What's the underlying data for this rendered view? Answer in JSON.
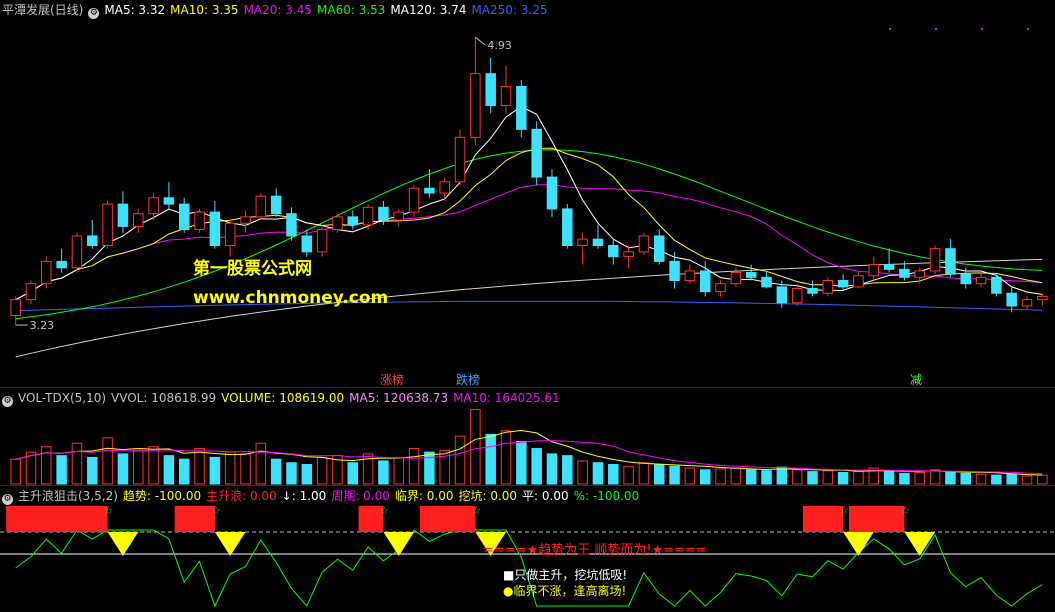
{
  "main": {
    "title": "平潭发展(日线)",
    "ma": [
      {
        "label": "MA5: 3.32",
        "color": "#ffffff"
      },
      {
        "label": "MA10: 3.35",
        "color": "#ffff00"
      },
      {
        "label": "MA20: 3.45",
        "color": "#ff00ff"
      },
      {
        "label": "MA60: 3.53",
        "color": "#00ff00"
      },
      {
        "label": "MA120: 3.74",
        "color": "#ffffff"
      },
      {
        "label": "MA250: 3.25",
        "color": "#3060ff"
      }
    ],
    "high_label": "4.93",
    "low_label": "3.23",
    "watermark_cn": "第一股票公式网",
    "watermark_url": "www.chnmoney.com",
    "events": [
      {
        "text": "涨榜",
        "color": "#ff4040"
      },
      {
        "text": "跌榜",
        "color": "#40a0ff"
      },
      {
        "text": "减",
        "color": "#40ff40"
      }
    ]
  },
  "vol": {
    "items": [
      {
        "label": "VOL-TDX(5,10)",
        "color": "#c0c0c0"
      },
      {
        "label": "VVOL: 108618.99",
        "color": "#c0c0c0"
      },
      {
        "label": "VOLUME: 108619.00",
        "color": "#ffff00"
      },
      {
        "label": "MA5: 120638.73",
        "color": "#ff80ff"
      },
      {
        "label": "MA10: 164025.61",
        "color": "#ff00ff"
      }
    ]
  },
  "ind": {
    "items": [
      {
        "label": "主升浪狙击(3,5,2)",
        "color": "#c0c0c0"
      },
      {
        "label": "趋势: -100.00",
        "color": "#ffff00"
      },
      {
        "label": "主升浪: 0.00",
        "color": "#ff2020"
      },
      {
        "label": "↓: 1.00",
        "color": "#ffffff"
      },
      {
        "label": "周期: 0.00",
        "color": "#ff00ff"
      },
      {
        "label": "临界: 0.00",
        "color": "#ffff00"
      },
      {
        "label": "挖坑: 0.00",
        "color": "#ffff00"
      },
      {
        "label": "平: 0.00",
        "color": "#ffffff"
      },
      {
        "label": "%: -100.00",
        "color": "#00ff00"
      }
    ],
    "slogan": "====★趋势为王 顺势而为!★====",
    "note1": "■只做主升，挖坑低吸!",
    "note2": "●临界不涨，逢高离场!"
  },
  "colors": {
    "up": "#ff3030",
    "down": "#40e0ff",
    "ma5": "#ffffff",
    "ma10": "#ffff00",
    "ma20": "#ff00ff",
    "ma60": "#00ff00",
    "ma120": "#ffffff",
    "ma250": "#3060ff"
  },
  "chart_data": {
    "type": "line",
    "title": "平潭发展(日线)",
    "ohlc": [
      [
        3.18,
        3.3,
        3.12,
        3.28
      ],
      [
        3.28,
        3.4,
        3.25,
        3.38
      ],
      [
        3.38,
        3.55,
        3.35,
        3.52
      ],
      [
        3.52,
        3.6,
        3.45,
        3.48
      ],
      [
        3.48,
        3.7,
        3.45,
        3.68
      ],
      [
        3.68,
        3.78,
        3.6,
        3.62
      ],
      [
        3.62,
        3.9,
        3.6,
        3.88
      ],
      [
        3.88,
        3.96,
        3.7,
        3.74
      ],
      [
        3.74,
        3.85,
        3.7,
        3.82
      ],
      [
        3.82,
        3.95,
        3.78,
        3.92
      ],
      [
        3.92,
        4.02,
        3.85,
        3.88
      ],
      [
        3.88,
        3.92,
        3.7,
        3.72
      ],
      [
        3.72,
        3.85,
        3.7,
        3.83
      ],
      [
        3.83,
        3.9,
        3.6,
        3.62
      ],
      [
        3.62,
        3.78,
        3.55,
        3.76
      ],
      [
        3.76,
        3.84,
        3.7,
        3.8
      ],
      [
        3.8,
        3.95,
        3.78,
        3.93
      ],
      [
        3.93,
        3.98,
        3.8,
        3.82
      ],
      [
        3.82,
        3.86,
        3.65,
        3.68
      ],
      [
        3.68,
        3.72,
        3.55,
        3.58
      ],
      [
        3.58,
        3.75,
        3.55,
        3.72
      ],
      [
        3.72,
        3.82,
        3.7,
        3.8
      ],
      [
        3.8,
        3.84,
        3.72,
        3.75
      ],
      [
        3.75,
        3.88,
        3.72,
        3.86
      ],
      [
        3.86,
        3.9,
        3.75,
        3.78
      ],
      [
        3.78,
        3.85,
        3.74,
        3.83
      ],
      [
        3.83,
        4.0,
        3.8,
        3.98
      ],
      [
        3.98,
        4.1,
        3.92,
        3.95
      ],
      [
        3.95,
        4.05,
        3.9,
        4.02
      ],
      [
        4.02,
        4.35,
        4.0,
        4.3
      ],
      [
        4.3,
        4.93,
        4.25,
        4.7
      ],
      [
        4.7,
        4.8,
        4.45,
        4.5
      ],
      [
        4.5,
        4.75,
        4.45,
        4.62
      ],
      [
        4.62,
        4.66,
        4.3,
        4.35
      ],
      [
        4.35,
        4.4,
        4.0,
        4.05
      ],
      [
        4.05,
        4.1,
        3.8,
        3.85
      ],
      [
        3.85,
        3.88,
        3.6,
        3.62
      ],
      [
        3.62,
        3.7,
        3.5,
        3.66
      ],
      [
        3.66,
        3.75,
        3.6,
        3.62
      ],
      [
        3.62,
        3.66,
        3.5,
        3.55
      ],
      [
        3.55,
        3.62,
        3.48,
        3.58
      ],
      [
        3.58,
        3.7,
        3.56,
        3.68
      ],
      [
        3.68,
        3.72,
        3.5,
        3.52
      ],
      [
        3.52,
        3.58,
        3.35,
        3.4
      ],
      [
        3.4,
        3.5,
        3.38,
        3.46
      ],
      [
        3.46,
        3.52,
        3.3,
        3.33
      ],
      [
        3.33,
        3.4,
        3.3,
        3.38
      ],
      [
        3.38,
        3.48,
        3.36,
        3.45
      ],
      [
        3.45,
        3.5,
        3.4,
        3.42
      ],
      [
        3.42,
        3.46,
        3.35,
        3.36
      ],
      [
        3.36,
        3.4,
        3.23,
        3.26
      ],
      [
        3.26,
        3.38,
        3.24,
        3.35
      ],
      [
        3.35,
        3.4,
        3.3,
        3.32
      ],
      [
        3.32,
        3.42,
        3.3,
        3.4
      ],
      [
        3.4,
        3.44,
        3.34,
        3.36
      ],
      [
        3.36,
        3.45,
        3.35,
        3.43
      ],
      [
        3.43,
        3.55,
        3.4,
        3.5
      ],
      [
        3.5,
        3.6,
        3.45,
        3.47
      ],
      [
        3.47,
        3.52,
        3.4,
        3.42
      ],
      [
        3.42,
        3.48,
        3.38,
        3.46
      ],
      [
        3.46,
        3.62,
        3.44,
        3.6
      ],
      [
        3.6,
        3.66,
        3.42,
        3.44
      ],
      [
        3.44,
        3.48,
        3.35,
        3.38
      ],
      [
        3.38,
        3.45,
        3.36,
        3.42
      ],
      [
        3.42,
        3.44,
        3.3,
        3.32
      ],
      [
        3.32,
        3.36,
        3.2,
        3.24
      ],
      [
        3.24,
        3.3,
        3.22,
        3.28
      ],
      [
        3.28,
        3.32,
        3.24,
        3.3
      ]
    ],
    "volume": [
      140,
      180,
      210,
      160,
      230,
      150,
      260,
      170,
      190,
      210,
      160,
      140,
      200,
      150,
      180,
      170,
      230,
      140,
      120,
      110,
      150,
      160,
      120,
      170,
      130,
      150,
      200,
      180,
      190,
      270,
      420,
      280,
      300,
      240,
      200,
      170,
      160,
      130,
      120,
      110,
      100,
      120,
      110,
      100,
      90,
      80,
      85,
      90,
      80,
      75,
      95,
      80,
      70,
      75,
      65,
      70,
      90,
      75,
      60,
      65,
      80,
      70,
      60,
      55,
      50,
      55,
      45,
      50
    ],
    "annotations": [
      "4.93",
      "3.23"
    ]
  }
}
